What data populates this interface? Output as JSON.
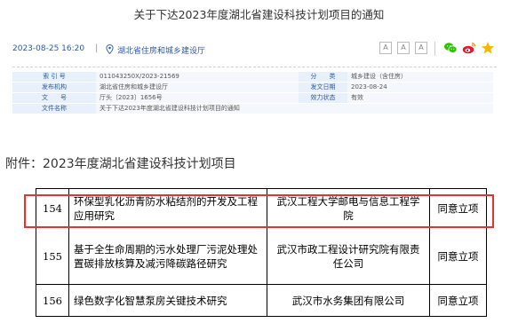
{
  "page": {
    "title": "关于下达2023年度湖北省建设科技计划项目的通知"
  },
  "meta": {
    "date": "2023-08-25 16:20",
    "separator": "|",
    "source": "湖北省住房和城乡建设厅",
    "font_buttons": [
      "A",
      "A",
      "A"
    ],
    "share_icons": [
      "wechat-icon",
      "weibo-icon",
      "favorite-star-icon"
    ]
  },
  "info_table": {
    "rows": [
      {
        "k1": "索 引 号",
        "v1": "011043250X/2023-21569",
        "k2": "分　　类",
        "v2": "城乡建设（含住房）"
      },
      {
        "k1": "发布机构",
        "v1": "湖北省住房和城乡建设厅",
        "k2": "发文日期",
        "v2": "2023-08-24"
      },
      {
        "k1": "文　　号",
        "v1": "厅头〔2023〕1656号",
        "k2": "效力状态",
        "v2": "有效"
      },
      {
        "k1": "文件名称",
        "v1": "关于下达2023年度湖北省建设科技计划项目的通知",
        "k2": "",
        "v2": ""
      }
    ]
  },
  "attachment": {
    "heading": "附件：2023年度湖北省建设科技计划项目"
  },
  "projects": [
    {
      "no": "154",
      "name": "环保型乳化沥青防水粘结剂的开发及工程应用研究",
      "org": "武汉工程大学邮电与信息工程学院",
      "status": "同意立项"
    },
    {
      "no": "155",
      "name": "基于全生命周期的污水处理厂污泥处理处置碳排放核算及减污降碳路径研究",
      "org": "武汉市政工程设计研究院有限责任公司",
      "status": "同意立项"
    },
    {
      "no": "156",
      "name": "绿色数字化智慧泵房关键技术研究",
      "org": "武汉市水务集团有限公司",
      "status": "同意立项"
    }
  ],
  "colors": {
    "link": "#2c5aa0",
    "highlight": "#e3342f",
    "info_key_bg": "#e8f1fb",
    "info_value_bg": "#f4f8fc",
    "wechat": "#2dc100",
    "weibo": "#e6162d",
    "star": "#f5b700"
  }
}
